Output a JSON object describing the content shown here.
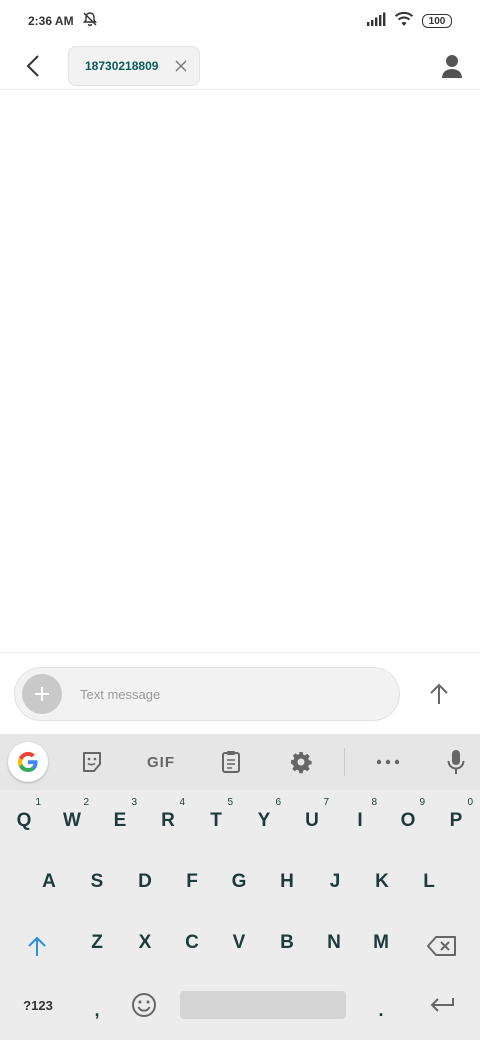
{
  "status_bar": {
    "time": "2:36 AM",
    "battery": "100"
  },
  "header": {
    "recipient": "18730218809"
  },
  "compose": {
    "placeholder": "Text message"
  },
  "keyboard": {
    "toolbar": {
      "gif_label": "GIF"
    },
    "row1": [
      {
        "label": "Q",
        "hint": "1"
      },
      {
        "label": "W",
        "hint": "2"
      },
      {
        "label": "E",
        "hint": "3"
      },
      {
        "label": "R",
        "hint": "4"
      },
      {
        "label": "T",
        "hint": "5"
      },
      {
        "label": "Y",
        "hint": "6"
      },
      {
        "label": "U",
        "hint": "7"
      },
      {
        "label": "I",
        "hint": "8"
      },
      {
        "label": "O",
        "hint": "9"
      },
      {
        "label": "P",
        "hint": "0"
      }
    ],
    "row2": [
      "A",
      "S",
      "D",
      "F",
      "G",
      "H",
      "J",
      "K",
      "L"
    ],
    "row3": [
      "Z",
      "X",
      "C",
      "V",
      "B",
      "N",
      "M"
    ],
    "symbols_label": "?123",
    "comma_label": ",",
    "period_label": "."
  }
}
